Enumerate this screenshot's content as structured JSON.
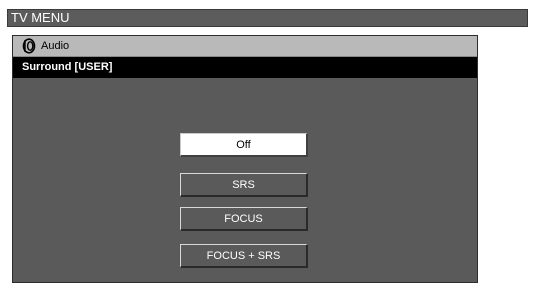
{
  "window": {
    "title": "TV MENU"
  },
  "menu": {
    "category": {
      "label": "Audio",
      "icon": "speaker-icon"
    },
    "submenu_title": "Surround [USER]",
    "options": [
      {
        "label": "Off",
        "selected": true
      },
      {
        "label": "SRS",
        "selected": false
      },
      {
        "label": "FOCUS",
        "selected": false
      },
      {
        "label": "FOCUS + SRS",
        "selected": false
      }
    ]
  },
  "colors": {
    "title_bar": "#5c5c5c",
    "panel": "#5a5a5a",
    "category_row": "#b9b9b9",
    "submenu_row": "#000000",
    "selected_option": "#ffffff"
  }
}
